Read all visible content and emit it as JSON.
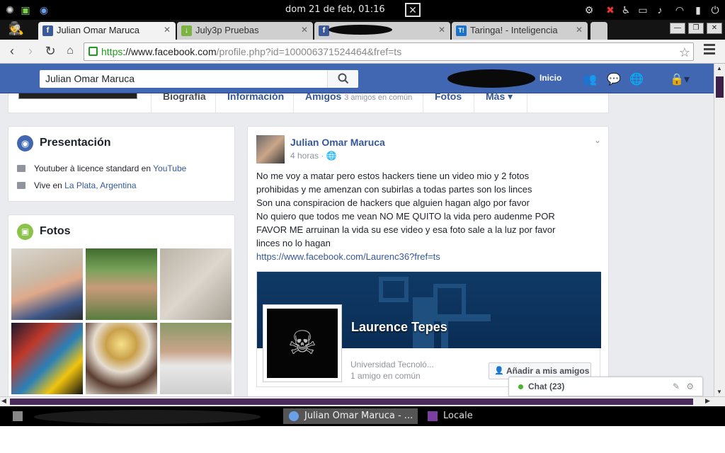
{
  "system": {
    "clock": "dom 21 de feb, 01:16"
  },
  "tabs": [
    {
      "title": "Julian Omar Maruca",
      "favicon": "f",
      "color": "#3b5998"
    },
    {
      "title": "July3p Pruebas",
      "favicon": "↓",
      "color": "#7cb342"
    },
    {
      "title": "",
      "favicon": "f",
      "color": "#3b5998"
    },
    {
      "title": "Taringa! - Inteligencia",
      "favicon": "T!",
      "color": "#1a73c6"
    }
  ],
  "address": {
    "https": "https",
    "host": "://www.facebook.com",
    "path": "/profile.php?id=100006371524464&fref=ts"
  },
  "fb": {
    "search_value": "Julian Omar Maruca",
    "home": "Inicio"
  },
  "profile_tabs": {
    "biografia": "Biografía",
    "informacion": "Información",
    "amigos": "Amigos",
    "amigos_common": "3 amigos en común",
    "fotos": "Fotos",
    "mas": "Más"
  },
  "intro": {
    "title": "Presentación",
    "work_prefix": "Youtuber à licence standard en",
    "work_link": "YouTube",
    "lives_prefix": "Vive en",
    "lives_link": "La Plata, Argentina"
  },
  "photos": {
    "title": "Fotos"
  },
  "post": {
    "author": "Julian Omar Maruca",
    "time": "4 horas",
    "lines": [
      "No me voy a matar pero estos hackers tiene un video mio y 2 fotos",
      "prohibidas y me amenzan con subirlas a todas partes son los linces",
      "Son una conspiracion de hackers que alguien hagan algo por favor",
      "No quiero que todos me vean NO ME QUITO la vida pero audenme POR",
      "FAVOR ME arruinan la vida su ese video y esa foto sale a la luz por favor",
      "linces no lo hagan"
    ],
    "link": "https://www.facebook.com/Laurenc36?fref=ts"
  },
  "shared": {
    "name": "Laurence Tepes",
    "school": "Universidad Tecnoló...",
    "mutual": "1 amigo en común",
    "add_button": "Añadir a mis amigos"
  },
  "chat": {
    "label": "Chat (23)"
  },
  "taskbar": {
    "item_active": "Julian Omar Maruca - ...",
    "item_locale": "Locale"
  }
}
